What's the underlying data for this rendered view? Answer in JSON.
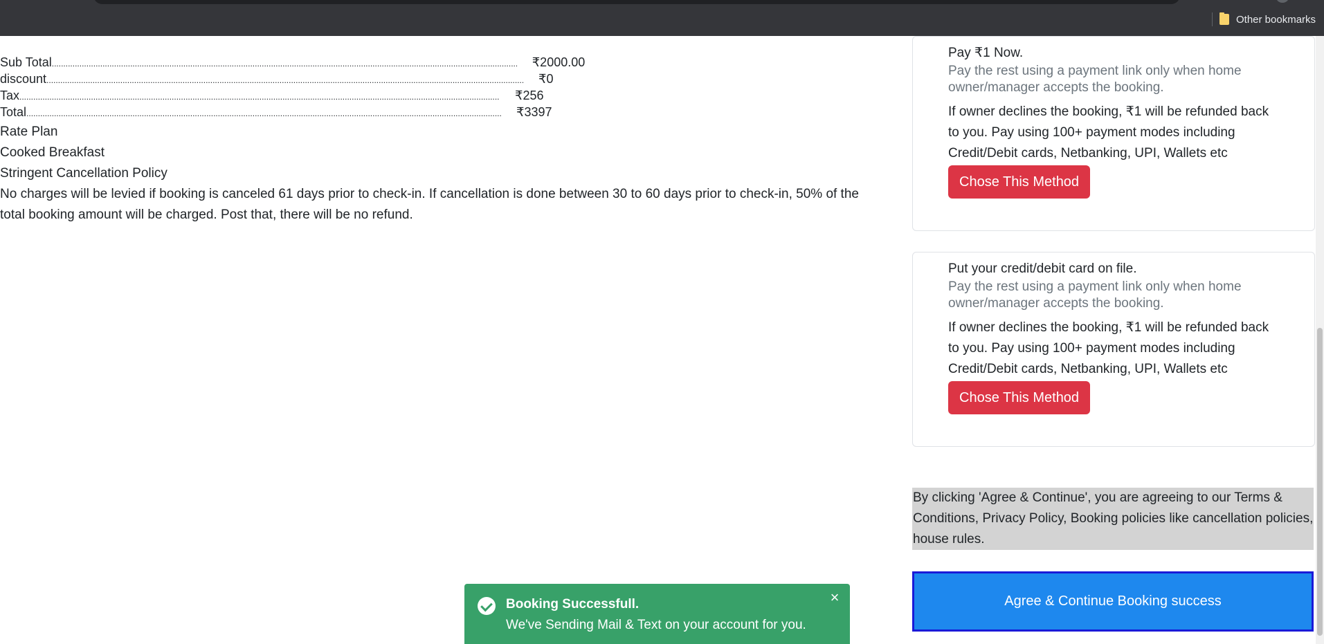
{
  "browser": {
    "bookmark_label": "Other bookmarks"
  },
  "summary": {
    "rows": [
      {
        "label": "Sub Total",
        "amount": "₹2000.00"
      },
      {
        "label": "discount",
        "amount": "₹0"
      },
      {
        "label": "Tax",
        "amount": "₹256"
      },
      {
        "label": "Total",
        "amount": "₹3397"
      }
    ],
    "rate_plan_heading": "Rate Plan",
    "rate_plan_value": "Cooked Breakfast",
    "policy_heading": "Stringent Cancellation Policy",
    "policy_text": "No charges will be levied if booking is canceled 61 days prior to check-in. If cancellation is done between 30 to 60 days prior to check-in, 50% of the total booking amount will be charged. Post that, there will be no refund."
  },
  "payment_methods": [
    {
      "title": "Pay ₹1 Now.",
      "subtitle": "Pay the rest using a payment link only when home owner/manager accepts the booking.",
      "details": "If owner declines the booking, ₹1 will be refunded back to you. Pay using 100+ payment modes including Credit/Debit cards, Netbanking, UPI, Wallets etc",
      "button_label": "Chose This Method"
    },
    {
      "title": "Put your credit/debit card on file.",
      "subtitle": "Pay the rest using a payment link only when home owner/manager accepts the booking.",
      "details": "If owner declines the booking, ₹1 will be refunded back to you. Pay using 100+ payment modes including Credit/Debit cards, Netbanking, UPI, Wallets etc",
      "button_label": "Chose This Method"
    }
  ],
  "terms_text": "By clicking 'Agree & Continue', you are agreeing to our Terms & Conditions, Privacy Policy, Booking policies like cancellation policies, house rules.",
  "agree_button_label": "Agree & Continue Booking success",
  "toast": {
    "title": "Booking Successfull.",
    "message": "We've Sending Mail & Text on your account for you.",
    "close_glyph": "×"
  },
  "colors": {
    "danger": "#dc3545",
    "primary": "#1e88ee",
    "success": "#38a169"
  }
}
